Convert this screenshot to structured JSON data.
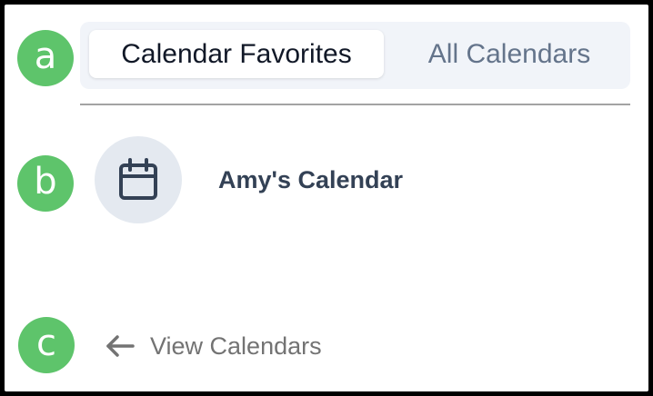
{
  "markers": {
    "a": "a",
    "b": "b",
    "c": "c"
  },
  "tabs": [
    {
      "label": "Calendar Favorites",
      "active": true
    },
    {
      "label": "All Calendars",
      "active": false
    }
  ],
  "calendars": [
    {
      "name": "Amy's Calendar",
      "icon": "calendar-icon"
    }
  ],
  "footer": {
    "back_label": "View Calendars",
    "back_icon": "arrow-left-icon"
  },
  "colors": {
    "marker": "#5ec46b",
    "tab_bar_bg": "#f1f4f9",
    "active_tab_text": "#111827",
    "inactive_tab_text": "#64748b",
    "avatar_bg": "#e4e9f0",
    "calendar_name_text": "#334155",
    "link_text": "#737373"
  }
}
